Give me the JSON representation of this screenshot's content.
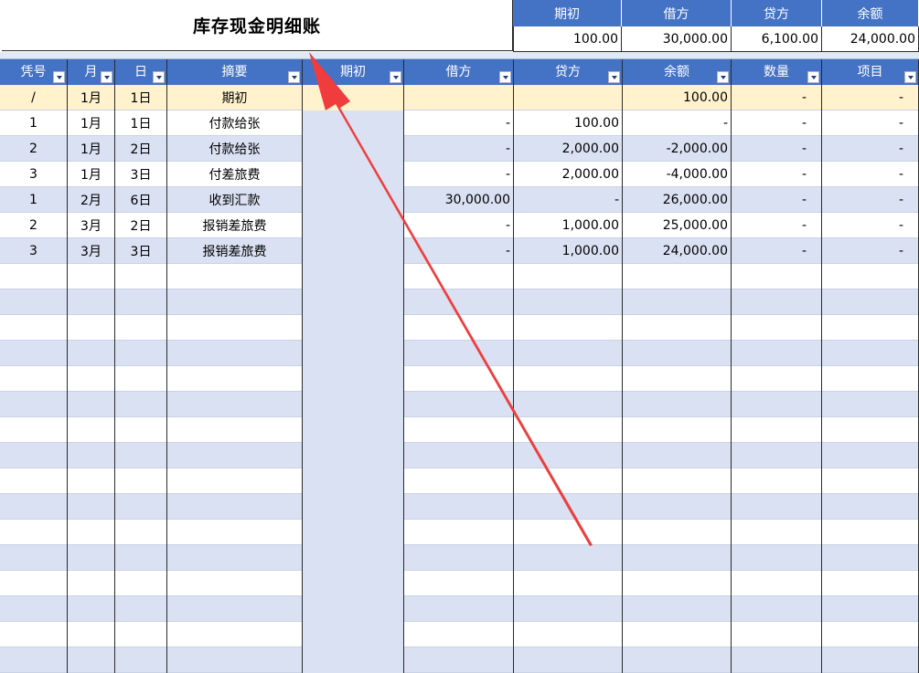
{
  "title": "库存现金明细账",
  "summary": {
    "headers": [
      "期初",
      "借方",
      "贷方",
      "余额"
    ],
    "values": [
      "100.00",
      "30,000.00",
      "6,100.00",
      "24,000.00"
    ]
  },
  "columns": [
    "凭号",
    "月",
    "日",
    "摘要",
    "期初",
    "借方",
    "贷方",
    "余额",
    "数量",
    "项目"
  ],
  "rows": [
    {
      "no": "/",
      "month": "1月",
      "day": "1日",
      "desc": "期初",
      "opening": "",
      "debit": "",
      "credit": "",
      "balance": "100.00",
      "qty": "-",
      "item": "-"
    },
    {
      "no": "1",
      "month": "1月",
      "day": "1日",
      "desc": "付款给张",
      "opening": "",
      "debit": "-",
      "credit": "100.00",
      "balance": "-",
      "qty": "-",
      "item": "-"
    },
    {
      "no": "2",
      "month": "1月",
      "day": "2日",
      "desc": "付款给张",
      "opening": "",
      "debit": "-",
      "credit": "2,000.00",
      "balance": "-2,000.00",
      "qty": "-",
      "item": "-"
    },
    {
      "no": "3",
      "month": "1月",
      "day": "3日",
      "desc": "付差旅费",
      "opening": "",
      "debit": "-",
      "credit": "2,000.00",
      "balance": "-4,000.00",
      "qty": "-",
      "item": "-"
    },
    {
      "no": "1",
      "month": "2月",
      "day": "6日",
      "desc": "收到汇款",
      "opening": "",
      "debit": "30,000.00",
      "credit": "-",
      "balance": "26,000.00",
      "qty": "-",
      "item": "-"
    },
    {
      "no": "2",
      "month": "3月",
      "day": "2日",
      "desc": "报销差旅费",
      "opening": "",
      "debit": "-",
      "credit": "1,000.00",
      "balance": "25,000.00",
      "qty": "-",
      "item": "-"
    },
    {
      "no": "3",
      "month": "3月",
      "day": "3日",
      "desc": "报销差旅费",
      "opening": "",
      "debit": "-",
      "credit": "1,000.00",
      "balance": "24,000.00",
      "qty": "-",
      "item": "-"
    }
  ],
  "empty_row_count": 16,
  "colors": {
    "header_blue": "#4472c4",
    "stripe_blue": "#d9e1f2",
    "opening_yellow": "#fff2cc",
    "arrow_red": "#f03c3c"
  }
}
